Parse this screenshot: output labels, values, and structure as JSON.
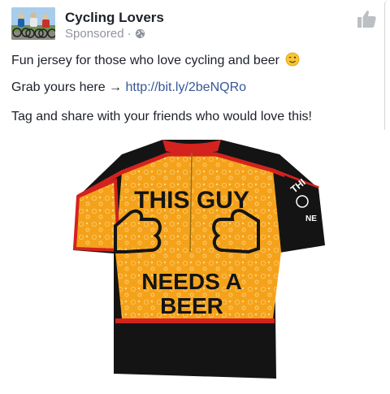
{
  "post": {
    "page_name": "Cycling Lovers",
    "sponsored_label": "Sponsored",
    "meta_separator": "·",
    "line1": "Fun jersey for those who love cycling and beer",
    "line2_prefix": "Grab yours here →",
    "link": "http://bit.ly/2beNQRo",
    "line3": "Tag and share with your friends who would love this!"
  },
  "jersey": {
    "front_top": "THIS GUY",
    "front_mid": "NEEDS A",
    "front_bottom": "BEER",
    "sleeve_top": "THI",
    "sleeve_bottom": "NE"
  },
  "icons": {
    "avatar": "cyclists-photo",
    "globe": "globe-icon",
    "like": "thumbs-up-icon",
    "emoji": "winking-face-emoji"
  },
  "colors": {
    "name": "#1d2129",
    "meta": "#90949c",
    "link": "#365899",
    "jersey_orange": "#f5a21b",
    "jersey_black": "#141414",
    "jersey_red": "#d2231e"
  }
}
